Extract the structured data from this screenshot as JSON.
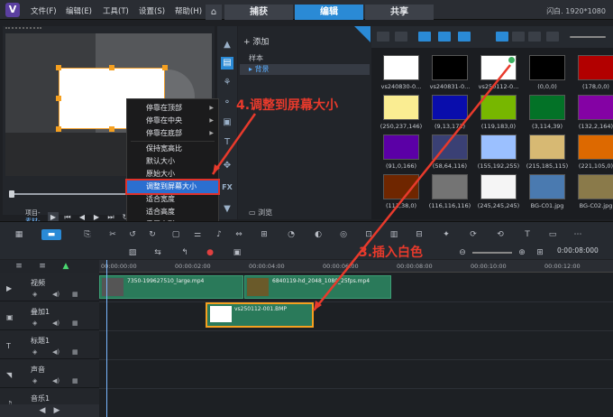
{
  "titlebar": {
    "logo": "V",
    "menus": [
      "文件(F)",
      "编辑(E)",
      "工具(T)",
      "设置(S)",
      "帮助(H)"
    ],
    "workspace_tabs": [
      {
        "label": "捕获",
        "active": false
      },
      {
        "label": "编辑",
        "active": true
      },
      {
        "label": "共享",
        "active": false
      }
    ],
    "resolution": "闪白.  1920*1080"
  },
  "preview": {
    "project_label": "项目-",
    "clip_label": "素材-"
  },
  "context_menu": {
    "items": [
      {
        "label": "停靠在顶部",
        "submenu": true
      },
      {
        "label": "停靠在中央",
        "submenu": true
      },
      {
        "label": "停靠在底部",
        "submenu": true
      },
      {
        "label": "保持宽高比",
        "submenu": false
      },
      {
        "label": "默认大小",
        "submenu": false
      },
      {
        "label": "原始大小",
        "submenu": false
      },
      {
        "label": "调整到屏幕大小",
        "submenu": false,
        "highlighted": true
      },
      {
        "label": "适合宽度",
        "submenu": false
      },
      {
        "label": "适合高度",
        "submenu": false
      },
      {
        "label": "重置变形",
        "submenu": false
      }
    ]
  },
  "library": {
    "add_label": "添加",
    "sample_label": "样本",
    "selected_folder": "背景",
    "browse_label": "浏览",
    "thumbnails": [
      {
        "label": "vs240830-0...",
        "color": "#ffffff"
      },
      {
        "label": "vs240831-0...",
        "color": "#000000"
      },
      {
        "label": "vs250112-0...",
        "color": "#ffffff",
        "checked": true
      },
      {
        "label": "(0,0,0)",
        "color": "#000000"
      },
      {
        "label": "(178,0,0)",
        "color": "#b20000"
      },
      {
        "label": "(250,237,146)",
        "color": "#faed92"
      },
      {
        "label": "(9,13,172)",
        "color": "#090dac"
      },
      {
        "label": "(119,183,0)",
        "color": "#77b700"
      },
      {
        "label": "(3,114,39)",
        "color": "#037227"
      },
      {
        "label": "(132,2,164)",
        "color": "#8402a4"
      },
      {
        "label": "(91,0,166)",
        "color": "#5b00a6"
      },
      {
        "label": "(58,64,116)",
        "color": "#3a4074"
      },
      {
        "label": "(155,192,255)",
        "color": "#9bc0ff"
      },
      {
        "label": "(215,185,115)",
        "color": "#d7b973"
      },
      {
        "label": "(221,105,0)",
        "color": "#dd6900"
      },
      {
        "label": "(111,38,0)",
        "color": "#6f2600"
      },
      {
        "label": "(116,116,116)",
        "color": "#747474"
      },
      {
        "label": "(245,245,245)",
        "color": "#f5f5f5"
      },
      {
        "label": "BG-C01.jpg",
        "color": "#4a7ab0"
      },
      {
        "label": "BG-C02.jpg",
        "color": "#8a7a4a"
      }
    ]
  },
  "toolbar": {
    "timecode": "0:00:08:000"
  },
  "timeline": {
    "ruler": [
      "00:00:00:00",
      "00:00:02:00",
      "00:00:04:00",
      "00:00:06:00",
      "00:00:08:00",
      "00:00:10:00",
      "00:00:12:00"
    ],
    "tracks": [
      {
        "name": "视频",
        "icon": "video-track-icon"
      },
      {
        "name": "叠加1",
        "icon": "overlay-track-icon"
      },
      {
        "name": "标题1",
        "icon": "title-track-icon"
      },
      {
        "name": "声音",
        "icon": "voice-track-icon"
      },
      {
        "name": "音乐1",
        "icon": "music-track-icon"
      }
    ],
    "clips": {
      "video1": "7350-199627510_large.mp4",
      "video2": "6840119-hd_2048_1080_25fps.mp4",
      "overlay": "vs250112-001.BMP"
    }
  },
  "annotations": {
    "step4": "4.调整到屏幕大小",
    "step3": "3.插入白色"
  },
  "colors": {
    "accent": "#2a8ad6",
    "annotation": "#e83a2c",
    "clip": "#2a7a5a",
    "selection": "#f5a020"
  }
}
